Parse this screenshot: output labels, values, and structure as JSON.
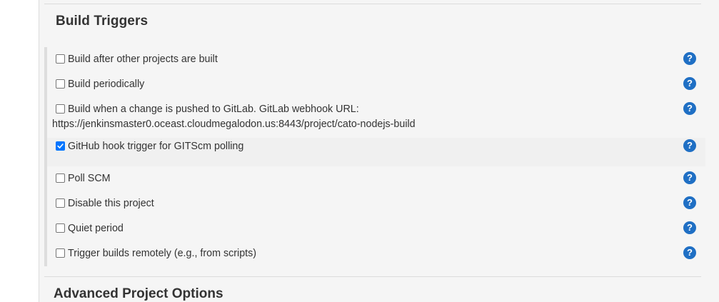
{
  "build_triggers": {
    "title": "Build Triggers",
    "help_glyph": "?",
    "options": [
      {
        "label": "Build after other projects are built",
        "checked": false
      },
      {
        "label": "Build periodically",
        "checked": false
      },
      {
        "label": "Build when a change is pushed to GitLab. GitLab webhook URL:",
        "sub_text": "https://jenkinsmaster0.oceast.cloudmegalodon.us:8443/project/cato-nodejs-build",
        "checked": false
      },
      {
        "label": "GitHub hook trigger for GITScm polling",
        "checked": true
      },
      {
        "label": "Poll SCM",
        "checked": false
      },
      {
        "label": "Disable this project",
        "checked": false
      },
      {
        "label": "Quiet period",
        "checked": false
      },
      {
        "label": "Trigger builds remotely (e.g., from scripts)",
        "checked": false
      }
    ]
  },
  "advanced": {
    "title": "Advanced Project Options"
  },
  "colors": {
    "help_icon": "#1f6fc4",
    "checkbox_checked": "#0075ff",
    "panel_bg": "#f5f5f5"
  },
  "icons": {
    "help": "help-question-icon",
    "check": "check-icon"
  }
}
